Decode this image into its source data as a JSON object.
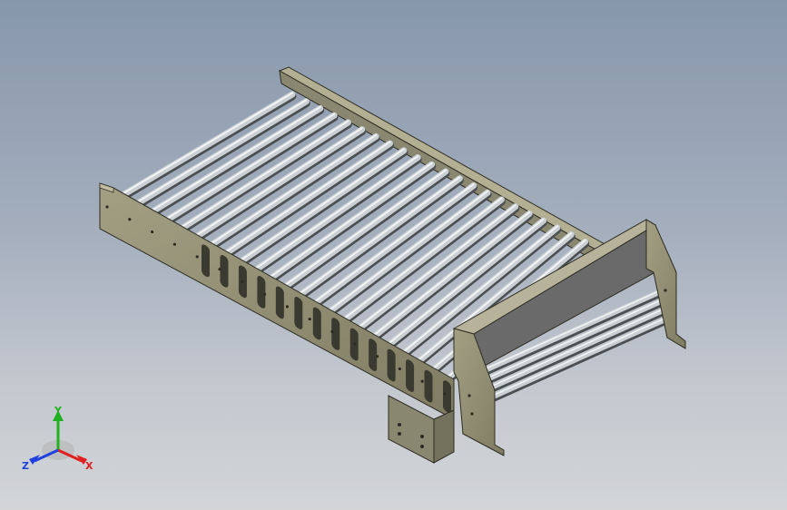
{
  "viewport": {
    "background_top": "#8797ab",
    "background_bottom": "#d3d5d7"
  },
  "model": {
    "name": "roller-conveyor-assembly",
    "frame_color": "#8f8c72",
    "frame_shadow": "#6e6b55",
    "roller_color": "#c9cfd2",
    "roller_count_main": 23,
    "roller_count_side": 4,
    "guard_panel_color": "#6a6a6a"
  },
  "triad": {
    "x_label": "X",
    "y_label": "Y",
    "z_label": "Z",
    "x_color": "#e02020",
    "y_color": "#20b020",
    "z_color": "#2040e0"
  }
}
